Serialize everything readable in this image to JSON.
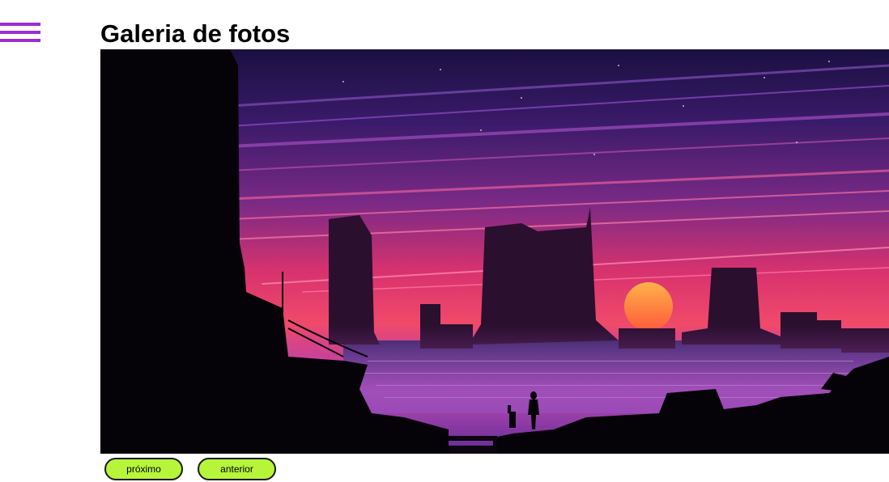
{
  "page": {
    "title": "Galeria de fotos"
  },
  "menu": {
    "icon": "hamburger-menu-icon",
    "color": "#9b2fd0"
  },
  "gallery": {
    "image_description_kind": "cyberpunk-city-sunset",
    "buttons": {
      "next_label": "próximo",
      "prev_label": "anterior"
    },
    "button_color": "#b6f53a"
  }
}
